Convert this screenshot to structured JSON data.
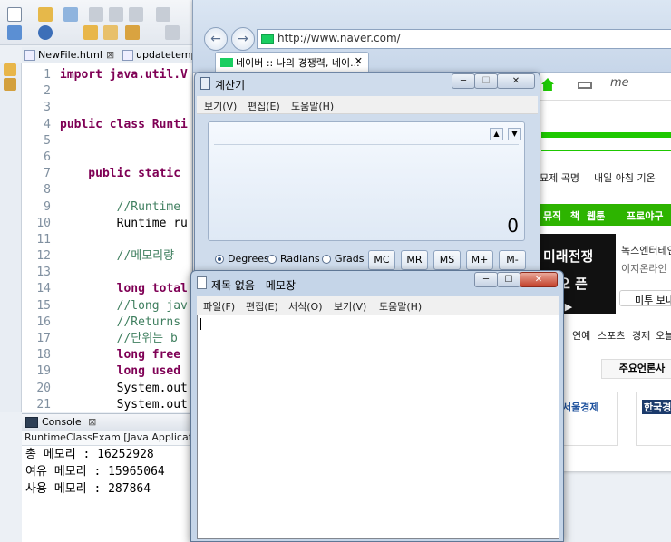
{
  "eclipse": {
    "editor_tabs": [
      {
        "label": "NewFile.html",
        "close": "⊠"
      },
      {
        "label": "updatetemp",
        "close": ""
      }
    ],
    "line_numbers": [
      "1",
      "2",
      "3",
      "4",
      "5",
      "6",
      "7",
      "8",
      "9",
      "10",
      "11",
      "12",
      "13",
      "14",
      "15",
      "16",
      "17",
      "18",
      "19",
      "20",
      "21"
    ],
    "code_lines": [
      "import java.util.V",
      "",
      "",
      "public class Runti",
      "",
      "",
      "    public static ",
      "",
      "        //Runtime ",
      "        Runtime ru",
      "",
      "        //메모리량",
      "",
      "        long total",
      "        //long jav",
      "        //Returns ",
      "        //단위는 b",
      "        long free",
      "        long used",
      "        System.out",
      "        System.out"
    ],
    "console": {
      "tab_label": "Console",
      "tab_close": "⊠",
      "description": "RuntimeClassExam [Java Application]",
      "output": [
        "총 메모리 : 16252928",
        "여유 메모리 : 15965064",
        "사용 메모리 : 287864"
      ]
    }
  },
  "browser": {
    "url": "http://www.naver.com/",
    "tab_title": "네이버 :: 나의 경쟁력, 네이...",
    "tab_close": "✕",
    "back_symbol": "←",
    "forward_symbol": "→",
    "page": {
      "top_right_text": "me",
      "menu_texts": [
        "묘제 곡명",
        "내일 아침 기온"
      ],
      "green_menu": [
        "뮤직",
        "책",
        "웹툰",
        "프로야구"
      ],
      "ad_big": "미래전쟁",
      "ad_sub": "오 픈",
      "ad_arrow": "가기 ▶",
      "side_news_1": "녹스엔터테인",
      "side_news_2": "이지온라인",
      "side_button": "미투 보내",
      "category_row": [
        "연예",
        "스포츠",
        "경제",
        "오늘"
      ],
      "main_press": "주요언론사",
      "press_1": "서울경제",
      "press_2": "한국경"
    }
  },
  "calculator": {
    "title": "계산기",
    "menu": [
      "보기(V)",
      "편집(E)",
      "도움말(H)"
    ],
    "display_value": "0",
    "angle_modes": [
      {
        "label": "Degrees",
        "selected": true
      },
      {
        "label": "Radians",
        "selected": false
      },
      {
        "label": "Grads",
        "selected": false
      }
    ],
    "memory_buttons": [
      "MC",
      "MR",
      "MS",
      "M+",
      "M-"
    ],
    "win_min": "─",
    "win_max": "☐",
    "win_close": "✕"
  },
  "notepad": {
    "title": "제목 없음 - 메모장",
    "menu": [
      "파일(F)",
      "편집(E)",
      "서식(O)",
      "보기(V)",
      "도움말(H)"
    ],
    "content": "",
    "win_min": "─",
    "win_max": "☐",
    "win_close": "✕"
  },
  "colors": {
    "naver_green": "#1ec800",
    "keyword": "#7f0055",
    "comment": "#3f7f5f"
  }
}
